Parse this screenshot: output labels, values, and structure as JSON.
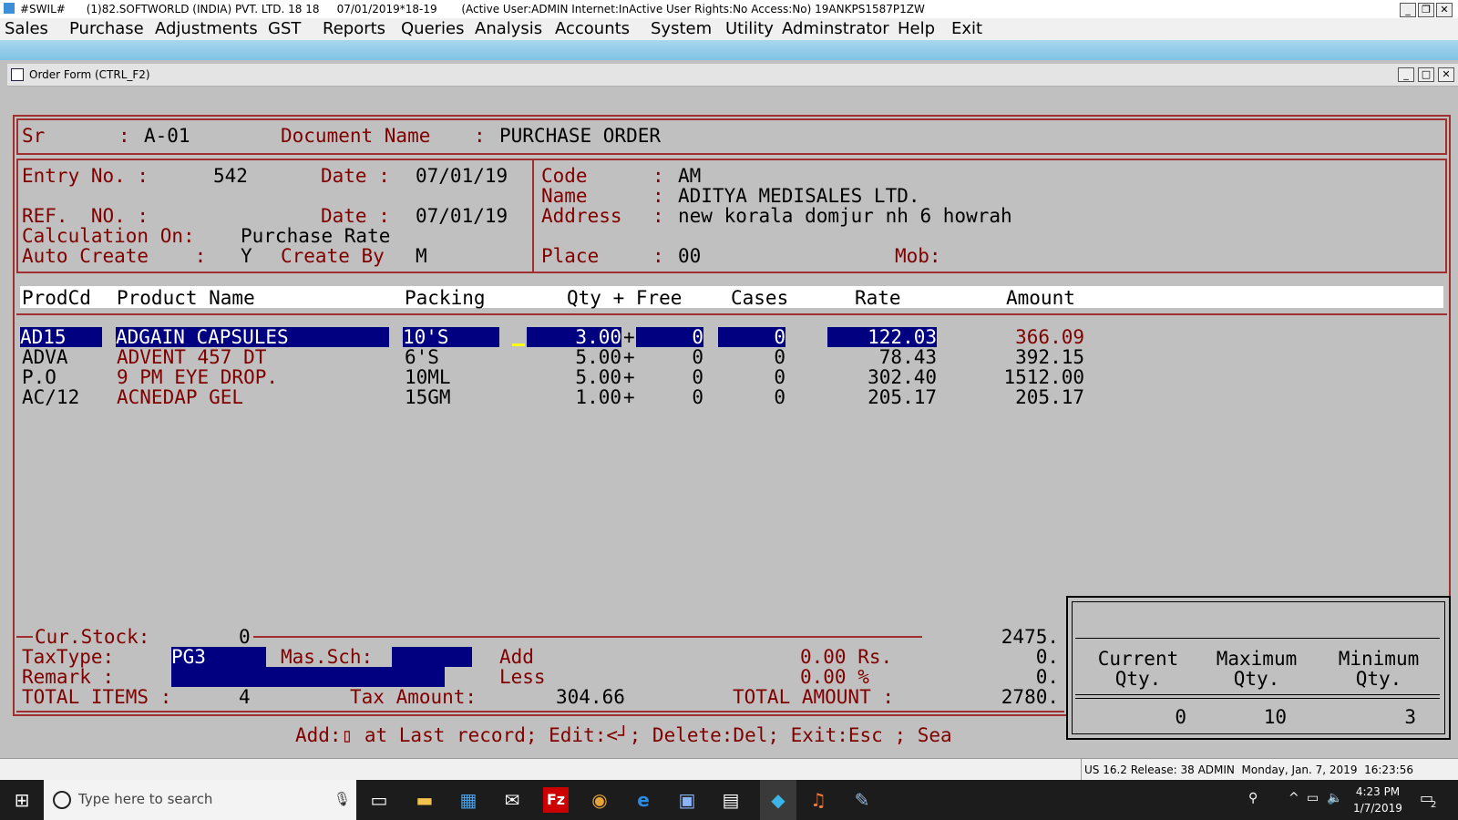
{
  "window": {
    "title": "#SWIL#      (1)82.SOFTWORLD (INDIA) PVT. LTD. 18 18     07/01/2019*18-19       (Active User:ADMIN Internet:InActive User Rights:No Access:No) 19ANKPS1587P1ZW"
  },
  "menu": [
    "Sales",
    "Purchase",
    "Adjustments",
    "GST",
    "Reports",
    "Queries",
    "Analysis",
    "Accounts",
    "System",
    "Utility",
    "Adminstrator",
    "Help",
    "Exit"
  ],
  "child_window": {
    "title": "Order Form (CTRL_F2)"
  },
  "doc": {
    "sr_label": "Sr",
    "sr_value": "A-01",
    "docname_label": "Document Name",
    "docname_value": "PURCHASE ORDER"
  },
  "entry": {
    "entry_label": "Entry No. :",
    "entry_value": "542",
    "date_label": "Date :",
    "date_value": "07/01/19",
    "ref_label": "REF.  NO. :",
    "ref_date_label": "Date :",
    "ref_date_value": "07/01/19",
    "calc_label": "Calculation On:",
    "calc_value": "Purchase Rate",
    "auto_label": "Auto Create    :",
    "auto_value": "Y",
    "createby_label": "Create By",
    "createby_value": "M"
  },
  "party": {
    "code_label": "Code",
    "code_value": "AM",
    "name_label": "Name",
    "name_value": "ADITYA MEDISALES LTD.",
    "address_label": "Address",
    "address_value": "new korala domjur nh 6 howrah",
    "place_label": "Place",
    "place_value": "00",
    "mob_label": "Mob:",
    "colon": ":"
  },
  "columns": {
    "prodcd": "ProdCd",
    "product": "Product Name",
    "packing": "Packing",
    "qtyfree": "Qty + Free",
    "cases": "Cases",
    "rate": "Rate",
    "amount": "Amount"
  },
  "rows": [
    {
      "code": "AD15",
      "name": "ADGAIN CAPSULES",
      "packing": "10'S",
      "qty": "3.00",
      "plus": "+",
      "free": "0",
      "cases": "0",
      "rate": "122.03",
      "amount": "366.09"
    },
    {
      "code": "ADVA",
      "name": "ADVENT 457 DT",
      "packing": "6'S",
      "qty": "5.00",
      "plus": "+",
      "free": "0",
      "cases": "0",
      "rate": "78.43",
      "amount": "392.15"
    },
    {
      "code": "P.O",
      "name": "9 PM EYE DROP.",
      "packing": "10ML",
      "qty": "5.00",
      "plus": "+",
      "free": "0",
      "cases": "0",
      "rate": "302.40",
      "amount": "1512.00"
    },
    {
      "code": "AC/12",
      "name": "ACNEDAP GEL",
      "packing": "15GM",
      "qty": "1.00",
      "plus": "+",
      "free": "0",
      "cases": "0",
      "rate": "205.17",
      "amount": "205.17"
    }
  ],
  "footer": {
    "curstock_label": "Cur.Stock:",
    "curstock_value": "0",
    "subtotal": "2475.",
    "taxtype_label": "TaxType:",
    "taxtype_value": "PG3",
    "massch_label": "Mas.Sch:",
    "add_label": "Add",
    "add_value": "0.00 Rs.",
    "add_total": "0.",
    "remark_label": "Remark :",
    "less_label": "Less",
    "less_value": "0.00 %",
    "less_total": "0.",
    "totalitems_label": "TOTAL ITEMS :",
    "totalitems_value": "4",
    "taxamount_label": "Tax Amount:",
    "taxamount_value": "304.66",
    "totalamount_label": "TOTAL AMOUNT :",
    "totalamount_value": "2780."
  },
  "hint": "Add:▯ at Last record; Edit:<┘; Delete:Del; Exit:Esc ; Sea",
  "qty_panel": {
    "current_label_1": "Current",
    "current_label_2": "Qty.",
    "maximum_label_1": "Maximum",
    "maximum_label_2": "Qty.",
    "minimum_label_1": "Minimum",
    "minimum_label_2": "Qty.",
    "current_value": "0",
    "maximum_value": "10",
    "minimum_value": "3"
  },
  "statusbar": {
    "text": "US 16.2 Release: 38 ADMIN  Monday, Jan. 7, 2019  16:23:56"
  },
  "taskbar": {
    "search_placeholder": "Type here to search",
    "time": "4:23 PM",
    "date": "1/7/2019",
    "notifications": "2"
  },
  "colors": {
    "label_red": "#800000",
    "highlight": "#000080",
    "border": "#a03030"
  }
}
